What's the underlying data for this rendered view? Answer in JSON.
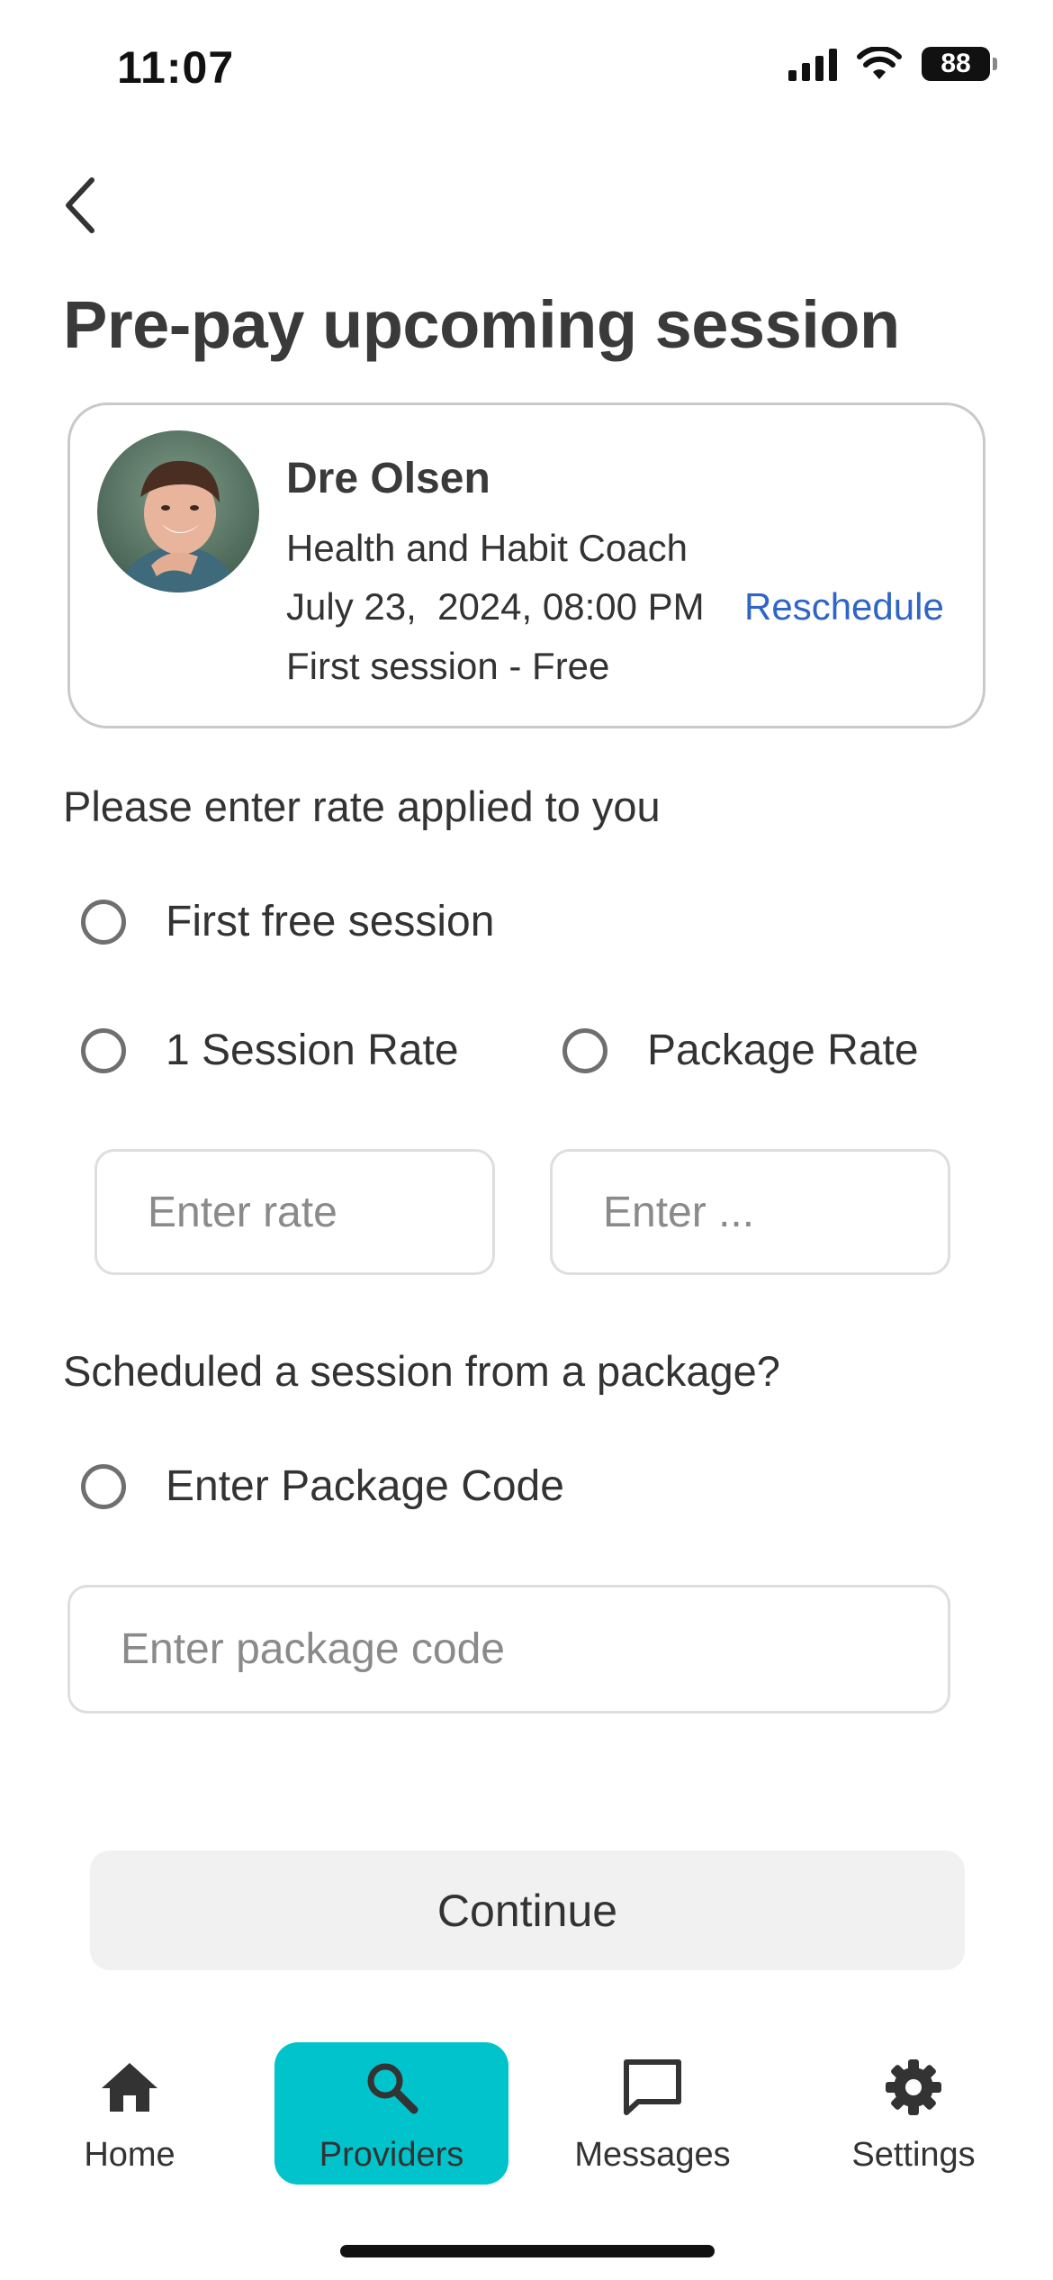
{
  "status_bar": {
    "time": "11:07",
    "battery": "88"
  },
  "header": {
    "title": "Pre-pay upcoming session"
  },
  "provider": {
    "name": "Dre Olsen",
    "role": "Health and Habit Coach",
    "datetime": "July 23,  2024, 08:00 PM",
    "reschedule_label": "Reschedule",
    "session_note": "First session - Free"
  },
  "rate_section": {
    "label": "Please enter rate applied to you",
    "option_free": "First free session",
    "option_single": "1 Session Rate",
    "option_package": "Package Rate",
    "single_rate_placeholder": "Enter rate",
    "package_rate_placeholder": "Enter ..."
  },
  "package_section": {
    "label": "Scheduled a session from a package?",
    "option_code": "Enter Package Code",
    "code_placeholder": "Enter package code"
  },
  "continue_label": "Continue",
  "nav": {
    "items": [
      {
        "label": "Home",
        "icon": "home-icon"
      },
      {
        "label": "Providers",
        "icon": "search-icon"
      },
      {
        "label": "Messages",
        "icon": "message-icon"
      },
      {
        "label": "Settings",
        "icon": "gear-icon"
      }
    ],
    "active": "Providers"
  },
  "colors": {
    "accent": "#00c3cb",
    "link": "#2f65c6",
    "text": "#333333"
  }
}
